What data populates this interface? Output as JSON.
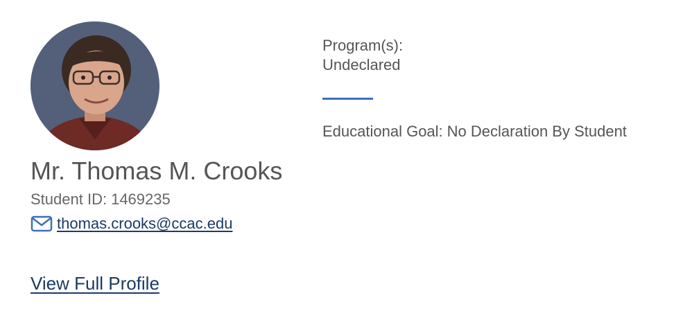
{
  "profile": {
    "name": "Mr. Thomas M. Crooks",
    "student_id_label": "Student ID:",
    "student_id": "1469235",
    "email": "thomas.crooks@ccac.edu",
    "view_full_profile": "View Full Profile"
  },
  "details": {
    "programs_label": "Program(s):",
    "programs_value": "Undeclared",
    "goal_label": "Educational Goal:",
    "goal_value": "No Declaration By Student"
  },
  "icons": {
    "email": "envelope-icon",
    "photo": "student-photo"
  },
  "colors": {
    "link": "#1c3a63",
    "accent": "#3b6fbf",
    "text": "#555555"
  }
}
